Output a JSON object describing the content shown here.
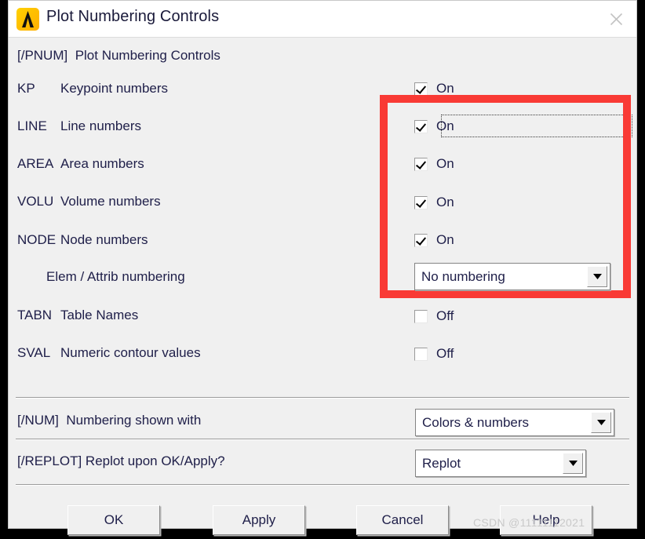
{
  "window": {
    "title": "Plot Numbering Controls",
    "icon": "ansys-logo-icon",
    "close_icon": "close-icon",
    "bg_color": "#f0f0f0",
    "highlight_color": "#f93a35"
  },
  "section_header": {
    "code": "[/PNUM]",
    "text": "Plot Numbering Controls"
  },
  "rows": [
    {
      "code": "KP",
      "label": "Keypoint numbers",
      "control": "checkbox",
      "state": "On",
      "checked": true,
      "focused": true
    },
    {
      "code": "LINE",
      "label": "Line numbers",
      "control": "checkbox",
      "state": "On",
      "checked": true,
      "focused": false
    },
    {
      "code": "AREA",
      "label": "Area numbers",
      "control": "checkbox",
      "state": "On",
      "checked": true,
      "focused": false
    },
    {
      "code": "VOLU",
      "label": "Volume numbers",
      "control": "checkbox",
      "state": "On",
      "checked": true,
      "focused": false
    },
    {
      "code": "NODE",
      "label": "Node numbers",
      "control": "checkbox",
      "state": "On",
      "checked": true,
      "focused": false
    },
    {
      "code": "",
      "label": "Elem / Attrib numbering",
      "control": "combo",
      "state": "No numbering",
      "checked": false,
      "focused": false
    },
    {
      "code": "TABN",
      "label": "Table Names",
      "control": "checkbox",
      "state": "Off",
      "checked": false,
      "focused": false
    },
    {
      "code": "SVAL",
      "label": "Numeric contour values",
      "control": "checkbox",
      "state": "Off",
      "checked": false,
      "focused": false
    }
  ],
  "num_section": {
    "code": "[/NUM]",
    "label": "Numbering shown with",
    "value": "Colors & numbers"
  },
  "replot_section": {
    "code": "[/REPLOT]",
    "label": "Replot upon OK/Apply?",
    "value": "Replot"
  },
  "buttons": [
    {
      "label": "OK"
    },
    {
      "label": "Apply"
    },
    {
      "label": "Cancel"
    },
    {
      "label": "Help"
    }
  ],
  "watermark": "CSDN @11111112021"
}
